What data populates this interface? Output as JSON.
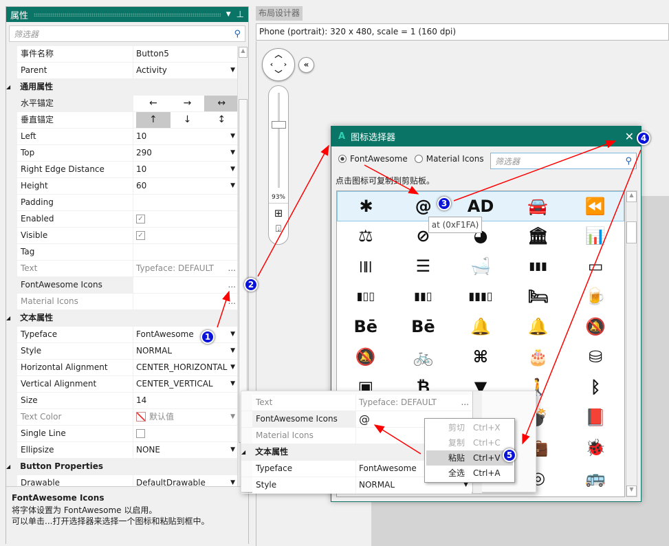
{
  "properties_panel": {
    "title": "属性",
    "filter_placeholder": "筛选器",
    "rows": [
      {
        "type": "prop",
        "name": "事件名称",
        "value": "Button5"
      },
      {
        "type": "prop",
        "name": "Parent",
        "value": "Activity",
        "dropdown": true
      },
      {
        "type": "section",
        "name": "通用属性"
      },
      {
        "type": "anchor",
        "name": "水平锚定",
        "options": [
          "←",
          "→",
          "↔"
        ],
        "selected": 2
      },
      {
        "type": "anchor",
        "name": "垂直锚定",
        "options": [
          "↑",
          "↓",
          "↕"
        ],
        "selected": 0
      },
      {
        "type": "prop",
        "name": "Left",
        "value": "10",
        "dropdown": true
      },
      {
        "type": "prop",
        "name": "Top",
        "value": "290",
        "dropdown": true
      },
      {
        "type": "prop",
        "name": "Right Edge Distance",
        "value": "10",
        "dropdown": true
      },
      {
        "type": "prop",
        "name": "Height",
        "value": "60",
        "dropdown": true
      },
      {
        "type": "prop",
        "name": "Padding",
        "value": ""
      },
      {
        "type": "check",
        "name": "Enabled",
        "checked": true
      },
      {
        "type": "check",
        "name": "Visible",
        "checked": true
      },
      {
        "type": "prop",
        "name": "Tag",
        "value": ""
      },
      {
        "type": "prop",
        "name": "Text",
        "value": "Typeface: DEFAULT",
        "dim": true,
        "ellipsis": true
      },
      {
        "type": "prop",
        "name": "FontAwesome Icons",
        "value": "",
        "ellipsis": true,
        "selected": true
      },
      {
        "type": "prop",
        "name": "Material Icons",
        "value": "",
        "dim": true,
        "ellipsis": true
      },
      {
        "type": "section",
        "name": "文本属性"
      },
      {
        "type": "prop",
        "name": "Typeface",
        "value": "FontAwesome",
        "dropdown": true
      },
      {
        "type": "prop",
        "name": "Style",
        "value": "NORMAL",
        "dropdown": true
      },
      {
        "type": "prop",
        "name": "Horizontal Alignment",
        "value": "CENTER_HORIZONTAL",
        "dropdown": true
      },
      {
        "type": "prop",
        "name": "Vertical Alignment",
        "value": "CENTER_VERTICAL",
        "dropdown": true
      },
      {
        "type": "prop",
        "name": "Size",
        "value": "14"
      },
      {
        "type": "prop",
        "name": "Text Color",
        "value": "默认值",
        "dim": true,
        "dropdown": true,
        "swatch": true
      },
      {
        "type": "check",
        "name": "Single Line",
        "checked": false
      },
      {
        "type": "prop",
        "name": "Ellipsize",
        "value": "NONE",
        "dropdown": true
      },
      {
        "type": "section",
        "name": "Button Properties"
      },
      {
        "type": "prop",
        "name": "Drawable",
        "value": "DefaultDrawable",
        "dropdown": true
      }
    ],
    "description": {
      "title": "FontAwesome Icons",
      "line1": "将字体设置为 FontAwesome 以启用。",
      "line2": "可以单击...打开选择器来选择一个图标和粘贴到框中。"
    }
  },
  "designer": {
    "tab": "布局设计器",
    "device": "Phone (portrait): 320 x 480, scale = 1 (160 dpi)",
    "zoom": "93%",
    "zoom_level": 0.93
  },
  "icon_picker": {
    "title": "图标选择器",
    "logo": "A",
    "radio_fontawesome": "FontAwesome",
    "radio_material": "Material Icons",
    "selected_font": "FontAwesome",
    "filter_placeholder": "筛选器",
    "hint": "点击图标可复制到剪贴板。",
    "tooltip": "at (0xF1FA)",
    "icons": [
      [
        "asterisk",
        "✱"
      ],
      [
        "at",
        "@"
      ],
      [
        "audio-description",
        "AD"
      ],
      [
        "automobile",
        "🚘"
      ],
      [
        "backward",
        "⏪"
      ],
      [
        "balance-scale",
        "⚖"
      ],
      [
        "ban",
        "⊘"
      ],
      [
        "bandcamp",
        "◕"
      ],
      [
        "bank",
        "🏛"
      ],
      [
        "bar-chart",
        "📊"
      ],
      [
        "barcode",
        "|‖|"
      ],
      [
        "bars",
        "☰"
      ],
      [
        "bath",
        "🛁"
      ],
      [
        "battery-full",
        "▮▮▮"
      ],
      [
        "battery-empty",
        "▭"
      ],
      [
        "battery-quarter",
        "▮▯▯"
      ],
      [
        "battery-half",
        "▮▮▯"
      ],
      [
        "battery-three-quarters",
        "▮▮▮▯"
      ],
      [
        "bed",
        "🛏"
      ],
      [
        "beer",
        "🍺"
      ],
      [
        "behance",
        "Bē"
      ],
      [
        "behance-square",
        "Bē"
      ],
      [
        "bell",
        "🔔"
      ],
      [
        "bell-o",
        "🔔"
      ],
      [
        "bell-slash",
        "🔕"
      ],
      [
        "bell-slash-o",
        "🔕"
      ],
      [
        "bicycle",
        "🚲"
      ],
      [
        "binoculars",
        "⌘"
      ],
      [
        "birthday-cake",
        "🎂"
      ],
      [
        "bitbucket",
        "⛁"
      ],
      [
        "bitbucket-square",
        "▣"
      ],
      [
        "bitcoin",
        "₿"
      ],
      [
        "black-tie",
        "▼"
      ],
      [
        "blind",
        "🚶"
      ],
      [
        "bluetooth",
        "ᛒ"
      ],
      [
        "",
        ""
      ],
      [
        "",
        ""
      ],
      [
        "",
        ""
      ],
      [
        "bomb",
        "💣"
      ],
      [
        "book",
        "📕"
      ],
      [
        "",
        ""
      ],
      [
        "",
        ""
      ],
      [
        "",
        ""
      ],
      [
        "briefcase",
        "💼"
      ],
      [
        "bug",
        "🐞"
      ],
      [
        "",
        ""
      ],
      [
        "",
        ""
      ],
      [
        "",
        ""
      ],
      [
        "bullseye",
        "◎"
      ],
      [
        "bus",
        "🚌"
      ]
    ]
  },
  "popup_grid": {
    "rows": [
      {
        "type": "prop",
        "name": "Text",
        "value": "Typeface: DEFAULT",
        "dim": true,
        "ellipsis": true
      },
      {
        "type": "prop",
        "name": "FontAwesome Icons",
        "value": "@",
        "selected": true
      },
      {
        "type": "prop",
        "name": "Material Icons",
        "value": "",
        "dim": true
      },
      {
        "type": "section",
        "name": "文本属性"
      },
      {
        "type": "prop",
        "name": "Typeface",
        "value": "FontAwesome"
      },
      {
        "type": "prop",
        "name": "Style",
        "value": "NORMAL",
        "dropdown": true
      }
    ]
  },
  "context_menu": [
    {
      "label": "剪切",
      "shortcut": "Ctrl+X",
      "enabled": false
    },
    {
      "label": "复制",
      "shortcut": "Ctrl+C",
      "enabled": false
    },
    {
      "label": "粘贴",
      "shortcut": "Ctrl+V",
      "enabled": true,
      "hover": true
    },
    {
      "label": "全选",
      "shortcut": "Ctrl+A",
      "enabled": true
    }
  ],
  "annotations": [
    "1",
    "2",
    "3",
    "4",
    "5"
  ],
  "colors": {
    "accent": "#0a7566",
    "annotation_badge": "#0a14d8",
    "arrow": "#ff0000"
  }
}
